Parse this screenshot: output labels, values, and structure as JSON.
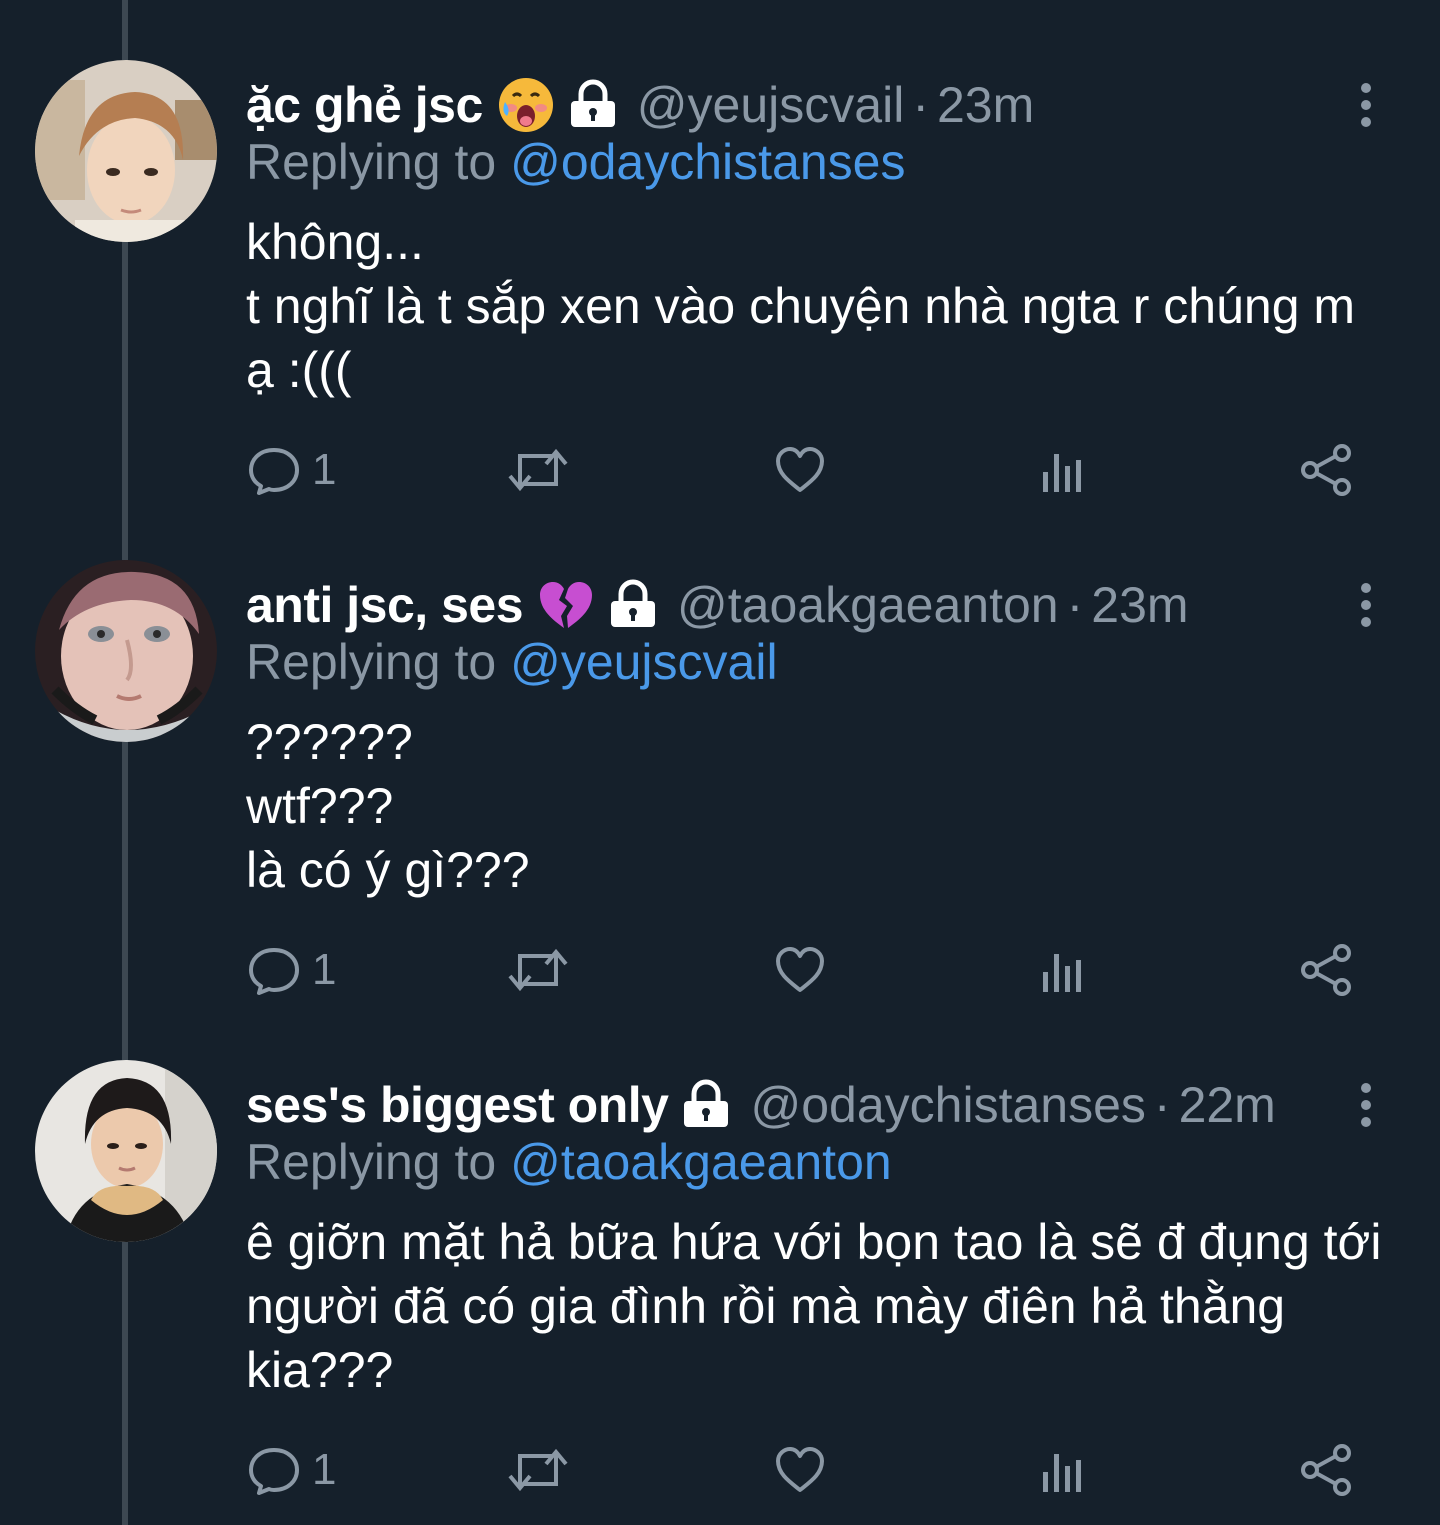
{
  "colors": {
    "background": "#15202b",
    "text_primary": "#ffffff",
    "text_secondary": "#8b98a5",
    "accent_link": "#4a99e9",
    "thread_line": "#3d4852"
  },
  "tweets": [
    {
      "display_name": "ặc ghẻ jsc",
      "name_emoji": "face-with-open-mouth-sweat-emoji",
      "protected": true,
      "handle": "@yeujscvail",
      "separator": "·",
      "time": "23m",
      "replying_label": "Replying to",
      "replying_to": "@odaychistanses",
      "text": "không...\nt nghĩ là t sắp xen vào chuyện nhà ngta r chúng m ạ :(((",
      "reply_count": "1"
    },
    {
      "display_name": "anti jsc, ses",
      "name_emoji": "broken-heart-emoji",
      "protected": true,
      "handle": "@taoakgaeanton",
      "separator": "·",
      "time": "23m",
      "replying_label": "Replying to",
      "replying_to": "@yeujscvail",
      "text": "??????\nwtf???\nlà có ý gì???",
      "reply_count": "1"
    },
    {
      "display_name": "ses's biggest only",
      "name_emoji": "",
      "protected": true,
      "handle": "@odaychistanses",
      "separator": "·",
      "time": "22m",
      "replying_label": "Replying to",
      "replying_to": "@taoakgaeanton",
      "text": "ê giỡn mặt hả bữa hứa với bọn tao là sẽ đ đụng tới người đã có gia đình rồi mà mày điên hả thằng kia???",
      "reply_count": "1"
    }
  ]
}
